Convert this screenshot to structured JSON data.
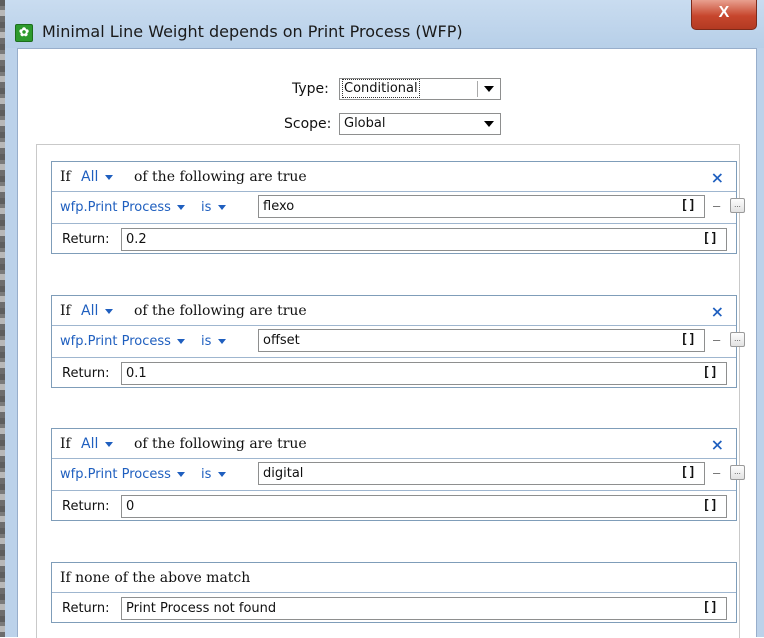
{
  "window": {
    "title": "Minimal Line Weight depends on Print Process (WFP)",
    "close_label": "X"
  },
  "form": {
    "type_label": "Type:",
    "type_value": "Conditional",
    "scope_label": "Scope:",
    "scope_value": "Global"
  },
  "groups": [
    {
      "if_prefix": "If",
      "quantifier": "All",
      "if_suffix": "of the following are true",
      "remove_label": "×",
      "property": "wfp.Print Process",
      "operator": "is",
      "value": "flexo",
      "brackets": "[]",
      "dash": "–",
      "more": "...",
      "return_label": "Return:",
      "return_value": "0.2",
      "return_brackets": "[]"
    },
    {
      "if_prefix": "If",
      "quantifier": "All",
      "if_suffix": "of the following are true",
      "remove_label": "×",
      "property": "wfp.Print Process",
      "operator": "is",
      "value": "offset",
      "brackets": "[]",
      "dash": "–",
      "more": "...",
      "return_label": "Return:",
      "return_value": "0.1",
      "return_brackets": "[]"
    },
    {
      "if_prefix": "If",
      "quantifier": "All",
      "if_suffix": "of the following are true",
      "remove_label": "×",
      "property": "wfp.Print Process",
      "operator": "is",
      "value": "digital",
      "brackets": "[]",
      "dash": "–",
      "more": "...",
      "return_label": "Return:",
      "return_value": "0",
      "return_brackets": "[]"
    }
  ],
  "fallback": {
    "header": "If none of the above match",
    "return_label": "Return:",
    "return_value": "Print Process not found",
    "return_brackets": "[]"
  },
  "colors": {
    "accent_blue": "#1f5fbf",
    "titlebar": "#bcd2ea",
    "close_red": "#c7462d"
  },
  "icons": {
    "app": "green-gear-icon",
    "close": "close-icon",
    "dropdown": "chevron-down-icon",
    "remove": "remove-x-icon",
    "more": "ellipsis-button-icon"
  }
}
